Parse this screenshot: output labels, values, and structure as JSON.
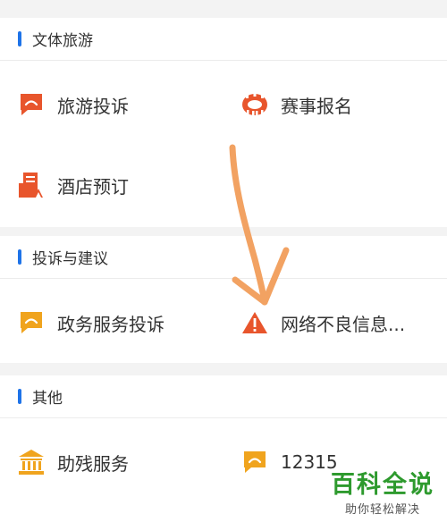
{
  "sections": [
    {
      "title": "文体旅游",
      "items": [
        {
          "label": "旅游投诉",
          "icon": "complaint-bubble-icon"
        },
        {
          "label": "赛事报名",
          "icon": "stadium-icon"
        },
        {
          "label": "酒店预订",
          "icon": "hotel-icon"
        }
      ]
    },
    {
      "title": "投诉与建议",
      "items": [
        {
          "label": "政务服务投诉",
          "icon": "complaint-bubble-icon"
        },
        {
          "label": "网络不良信息...",
          "icon": "warning-icon"
        }
      ]
    },
    {
      "title": "其他",
      "items": [
        {
          "label": "助残服务",
          "icon": "bank-icon"
        },
        {
          "label": "12315",
          "icon": "complaint-bubble-icon"
        }
      ]
    }
  ],
  "watermark": {
    "main": "百科全说",
    "sub": "助你轻松解决"
  },
  "colors": {
    "accent_bar": "#1e73e8",
    "icon_red": "#e8552c",
    "icon_orange": "#f0a41e",
    "arrow": "#f2a262"
  }
}
